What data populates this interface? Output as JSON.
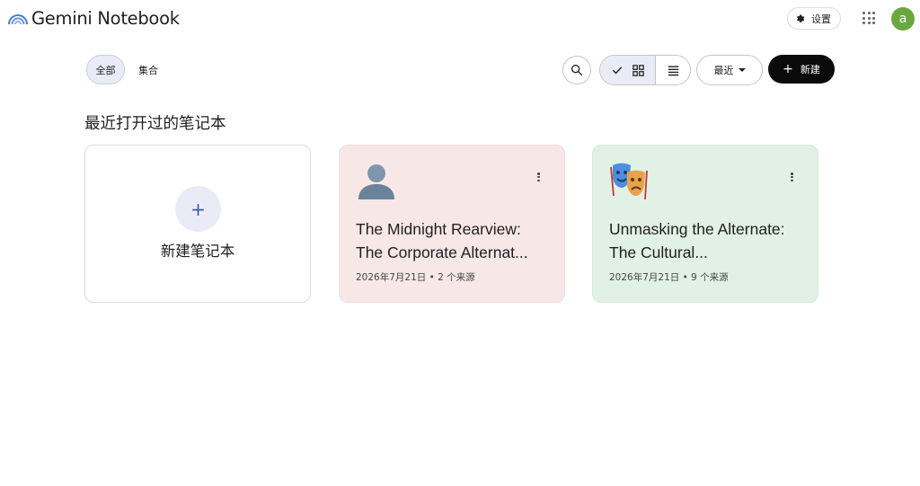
{
  "app": {
    "title": "Gemini Notebook"
  },
  "header": {
    "settings_label": "设置",
    "avatar_letter": "a",
    "avatar_color": "#6aa83e"
  },
  "toolbar": {
    "tabs": [
      {
        "label": "全部",
        "selected": true
      },
      {
        "label": "集合",
        "selected": false
      }
    ],
    "view_mode": "grid",
    "sort_label": "最近",
    "new_label": "新建"
  },
  "section": {
    "title": "最近打开过的笔记本"
  },
  "new_notebook_card": {
    "label": "新建笔记本",
    "plus": "+"
  },
  "notebooks": [
    {
      "icon": "person-silhouette-icon",
      "title": "The Midnight Rearview: The Corporate Alternat...",
      "meta": "2026年7月21日 • 2 个来源",
      "bg_color": "#f7e8e7"
    },
    {
      "icon": "theater-masks-icon",
      "title": "Unmasking the Alternate: The Cultural...",
      "meta": "2026年7月21日 • 9 个来源",
      "bg_color": "#e2f1e5"
    }
  ]
}
